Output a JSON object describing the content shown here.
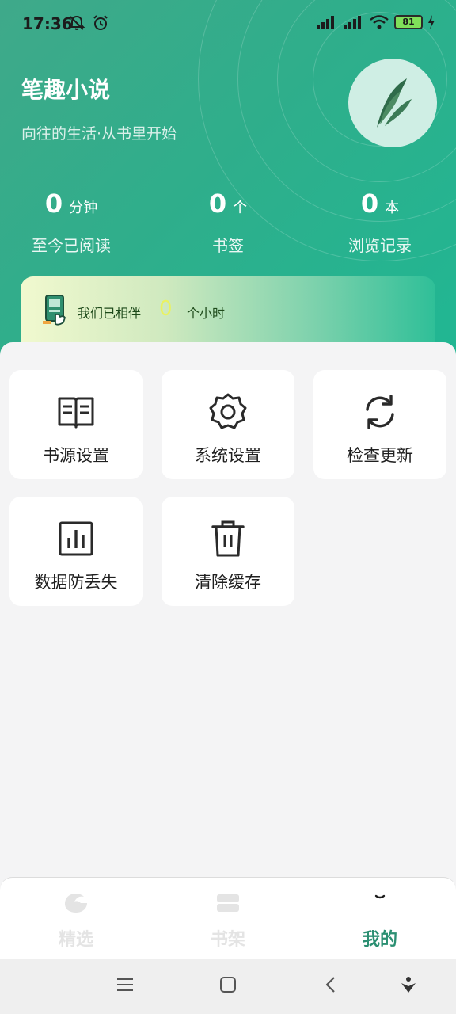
{
  "status_bar": {
    "time": "17:36",
    "battery": "81"
  },
  "header": {
    "title": "笔趣小说",
    "subtitle": "向往的生活·从书里开始",
    "stats": [
      {
        "value": "0",
        "unit": "分钟",
        "label": "至今已阅读"
      },
      {
        "value": "0",
        "unit": "个",
        "label": "书签"
      },
      {
        "value": "0",
        "unit": "本",
        "label": "浏览记录"
      }
    ],
    "companion": {
      "prefix": "我们已相伴",
      "value": "0",
      "suffix": "个小时"
    }
  },
  "tiles": [
    {
      "label": "书源设置",
      "icon": "book-open-icon"
    },
    {
      "label": "系统设置",
      "icon": "gear-icon"
    },
    {
      "label": "检查更新",
      "icon": "refresh-icon"
    },
    {
      "label": "数据防丢失",
      "icon": "bar-chart-icon"
    },
    {
      "label": "清除缓存",
      "icon": "trash-icon"
    }
  ],
  "bottom_nav": [
    {
      "label": "精选",
      "icon": "featured-icon",
      "active": false
    },
    {
      "label": "书架",
      "icon": "bookshelf-icon",
      "active": false
    },
    {
      "label": "我的",
      "icon": "profile-icon",
      "active": true
    }
  ],
  "colors": {
    "accent": "#2b8f72",
    "header_start": "#3fa98a",
    "header_end": "#20b793"
  }
}
